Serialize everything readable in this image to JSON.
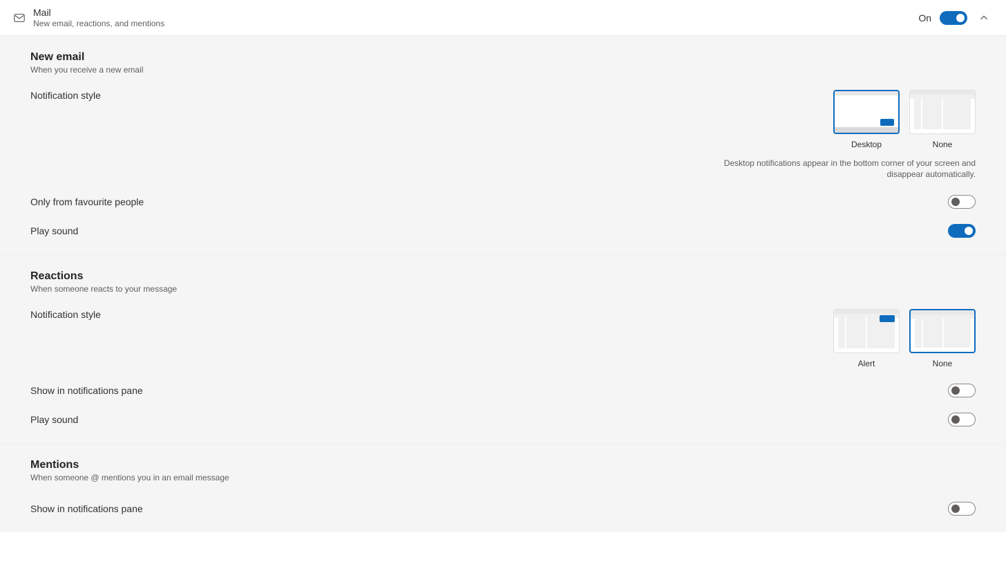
{
  "header": {
    "title": "Mail",
    "subtitle": "New email, reactions, and mentions",
    "status_label": "On",
    "toggle_on": true
  },
  "sections": {
    "new_email": {
      "title": "New email",
      "subtitle": "When you receive a new email",
      "notification_style_label": "Notification style",
      "options": {
        "desktop": "Desktop",
        "none": "None"
      },
      "selected_option": "desktop",
      "description": "Desktop notifications appear in the bottom corner of your screen and disappear automatically.",
      "only_favourite_label": "Only from favourite people",
      "only_favourite_on": false,
      "play_sound_label": "Play sound",
      "play_sound_on": true
    },
    "reactions": {
      "title": "Reactions",
      "subtitle": "When someone reacts to your message",
      "notification_style_label": "Notification style",
      "options": {
        "alert": "Alert",
        "none": "None"
      },
      "selected_option": "none",
      "show_in_pane_label": "Show in notifications pane",
      "show_in_pane_on": false,
      "play_sound_label": "Play sound",
      "play_sound_on": false
    },
    "mentions": {
      "title": "Mentions",
      "subtitle": "When someone @ mentions you in an email message",
      "show_in_pane_label": "Show in notifications pane",
      "show_in_pane_on": false
    }
  }
}
